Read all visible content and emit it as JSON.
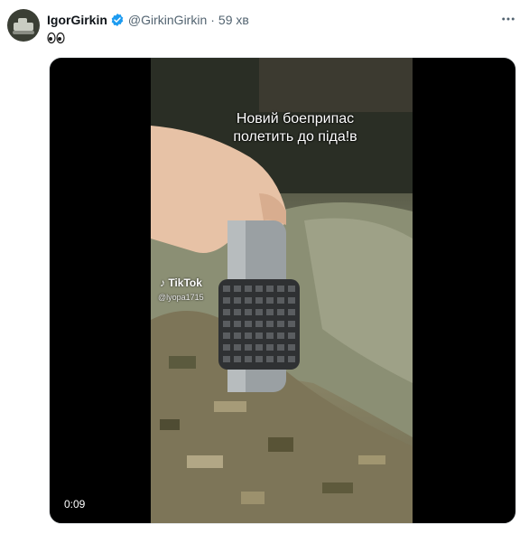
{
  "tweet": {
    "author": {
      "display_name": "IgorGirkin",
      "handle": "@GirkinGirkin",
      "verified": true,
      "avatar_icon": "tank-avatar-icon"
    },
    "separator": "·",
    "time_ago": "59 хв",
    "text_emoji": "eyes-emoji",
    "more_icon": "more-options-icon"
  },
  "media": {
    "type": "video",
    "overlay_caption_line1": "Новий боеприпас",
    "overlay_caption_line2": "полетить до піда!в",
    "watermark_brand": "TikTok",
    "watermark_user": "@lyopa1715",
    "elapsed_time": "0:09"
  },
  "colors": {
    "verified": "#1d9bf0",
    "text_primary": "#0f1419",
    "text_secondary": "#536471",
    "media_bg": "#000000"
  }
}
